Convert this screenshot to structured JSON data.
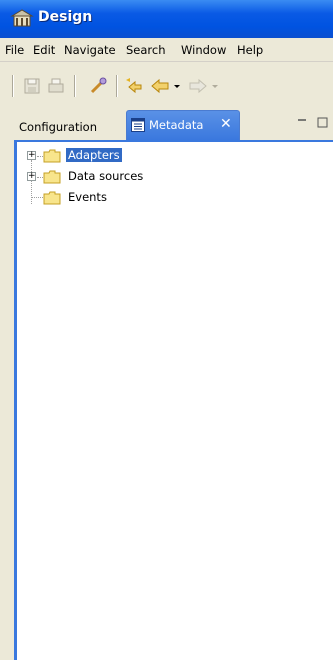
{
  "window": {
    "title": "Design"
  },
  "menu": [
    "File",
    "Edit",
    "Navigate",
    "Search",
    "Window",
    "Help"
  ],
  "tabs": [
    {
      "label": "Configuration",
      "active": false
    },
    {
      "label": "Metadata",
      "active": true,
      "close": "✕"
    }
  ],
  "tree": [
    {
      "label": "Adapters",
      "expandable": true,
      "selected": true
    },
    {
      "label": "Data sources",
      "expandable": true,
      "selected": false
    },
    {
      "label": "Events",
      "expandable": false,
      "selected": false
    }
  ],
  "icons": {
    "title": "app-icon",
    "toolbar": [
      "save-icon",
      "print-icon",
      "tool-icon",
      "last-edit-icon",
      "back-icon",
      "back-dropdown-icon",
      "forward-icon",
      "forward-dropdown-icon"
    ]
  },
  "colors": {
    "title_bar": "#0a5ae5",
    "selection": "#316ac5",
    "active_tab": "#3a78de"
  }
}
